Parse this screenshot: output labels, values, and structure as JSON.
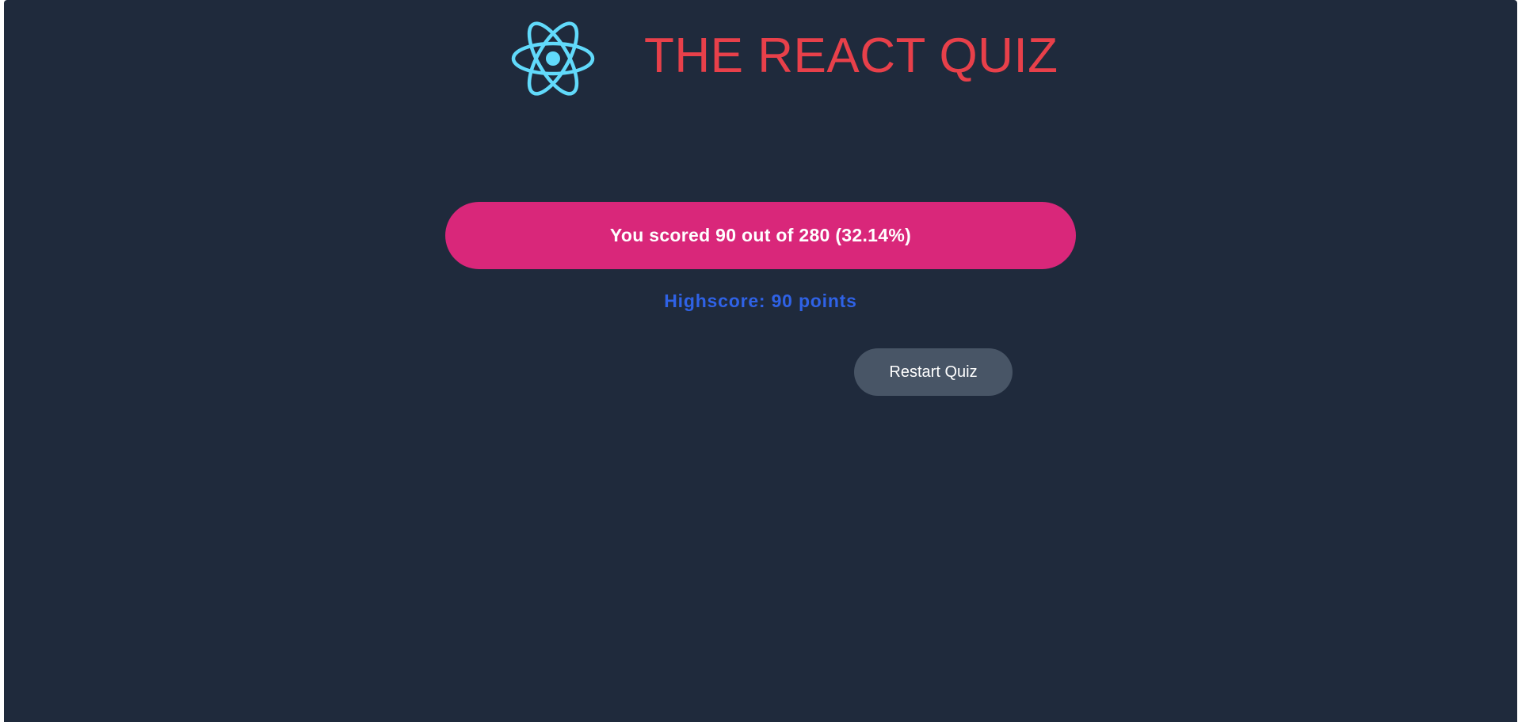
{
  "header": {
    "logo_icon": "react-atom-icon",
    "title": "THE REACT QUIZ"
  },
  "result": {
    "text": "You scored 90 out of 280 (32.14%)",
    "points": 90,
    "max_points": 280,
    "percentage": 32.14
  },
  "highscore": {
    "text": "Highscore: 90 points",
    "value": 90
  },
  "actions": {
    "restart_label": "Restart Quiz"
  },
  "colors": {
    "background": "#1f2a3c",
    "title": "#e8404a",
    "logo": "#61dafb",
    "result_bg": "#d9277a",
    "highscore": "#2f62e6",
    "button_bg": "#485566"
  }
}
